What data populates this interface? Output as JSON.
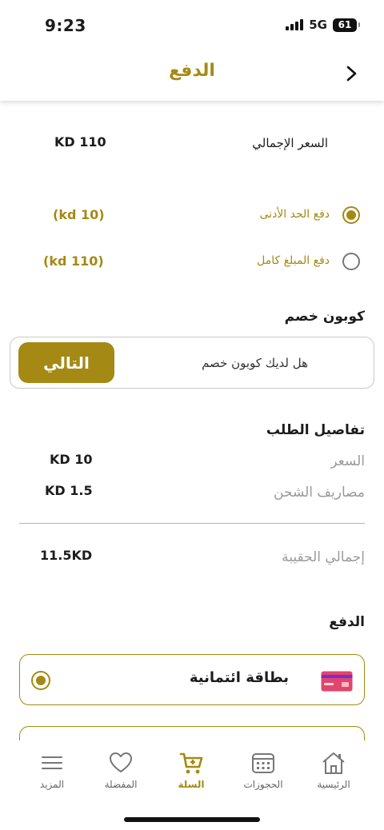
{
  "status": {
    "time": "9:23",
    "network": "5G",
    "battery": "61"
  },
  "header": {
    "title": "الدفع"
  },
  "total": {
    "label": "السعر الإجمالي",
    "value": "KD 110"
  },
  "payment_options": [
    {
      "label": "دفع الحد الأدنى",
      "amount": "(kd 10)",
      "selected": true
    },
    {
      "label": "دفع المبلغ كامل",
      "amount": "(kd 110)",
      "selected": false
    }
  ],
  "coupon": {
    "title": "كوبون خصم",
    "placeholder": "هل لديك كوبون خصم",
    "button_label": "التالي"
  },
  "order_details": {
    "title": "تفاصيل الطلب",
    "rows": [
      {
        "label": "السعر",
        "value": "KD 10"
      },
      {
        "label": "مصاريف الشحن",
        "value": "KD 1.5"
      }
    ],
    "bag_total": {
      "label": "إجمالي الحقيبة",
      "value": "11.5KD"
    }
  },
  "payment": {
    "title": "الدفع",
    "methods": [
      {
        "label": "بطاقة ائتمانية",
        "icon": "credit-card-icon",
        "selected": true
      }
    ]
  },
  "tabs": [
    {
      "label": "الرئيسية",
      "icon": "home-icon"
    },
    {
      "label": "الحجوزات",
      "icon": "calendar-icon"
    },
    {
      "label": "السلة",
      "icon": "cart-icon",
      "active": true
    },
    {
      "label": "المفضلة",
      "icon": "heart-icon"
    },
    {
      "label": "المزيد",
      "icon": "menu-icon"
    }
  ],
  "colors": {
    "accent": "#a48a14",
    "text": "#1c1c1c",
    "muted": "#9a9a9a"
  }
}
